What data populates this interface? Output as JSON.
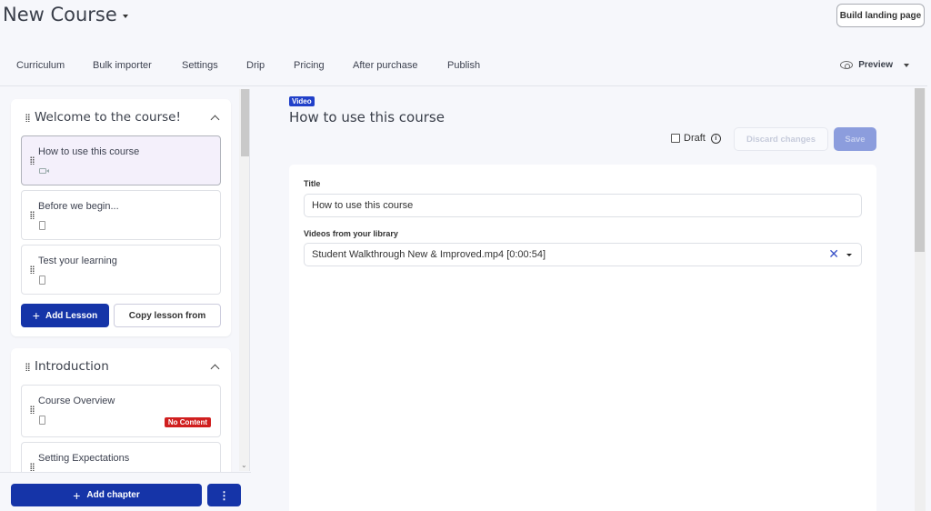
{
  "header": {
    "title": "New Course",
    "build_landing_page": "Build landing page",
    "preview": "Preview"
  },
  "tabs": [
    {
      "label": "Curriculum"
    },
    {
      "label": "Bulk importer"
    },
    {
      "label": "Settings"
    },
    {
      "label": "Drip"
    },
    {
      "label": "Pricing"
    },
    {
      "label": "After purchase"
    },
    {
      "label": "Publish"
    }
  ],
  "chapters": [
    {
      "title": "Welcome to the course!",
      "lessons": [
        {
          "title": "How to use this course",
          "icon": "video-icon",
          "active": true
        },
        {
          "title": "Before we begin...",
          "icon": "document-icon"
        },
        {
          "title": "Test your learning",
          "icon": "quiz-icon"
        }
      ],
      "add_lesson": "Add Lesson",
      "copy_lesson": "Copy lesson from"
    },
    {
      "title": "Introduction",
      "lessons": [
        {
          "title": "Course Overview",
          "icon": "document-icon",
          "badge": "No Content"
        },
        {
          "title": "Setting Expectations",
          "icon": "document-icon"
        }
      ]
    }
  ],
  "footer": {
    "add_chapter": "Add chapter",
    "more": "⋮"
  },
  "main": {
    "badge": "Video",
    "title": "How to use this course",
    "draft_label": "Draft",
    "draft_checked": false,
    "discard": "Discard changes",
    "save": "Save",
    "form": {
      "title_label": "Title",
      "title_value": "How to use this course",
      "video_label": "Videos from your library",
      "video_value": "Student Walkthrough New & Improved.mp4 [0:00:54]"
    }
  },
  "colors": {
    "primary": "#1534a8",
    "badge_video": "#2140c9",
    "badge_no_content": "#d01f1f",
    "save_disabled": "#8c9ddd"
  }
}
